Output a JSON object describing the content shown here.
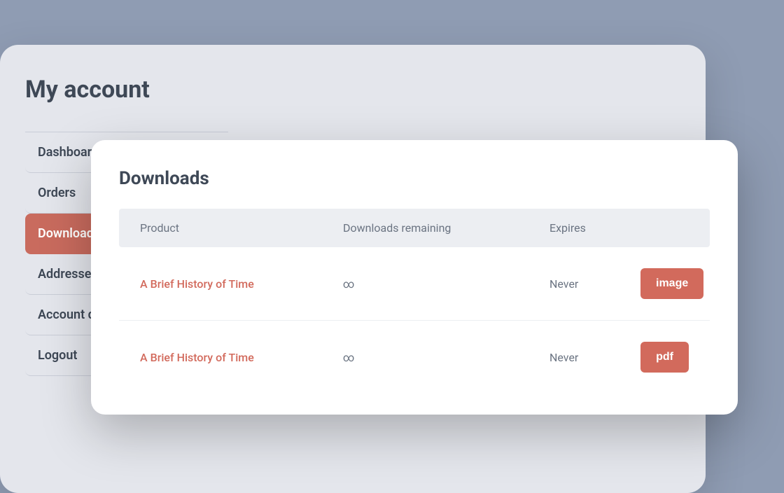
{
  "page": {
    "title": "My account"
  },
  "sidebar": {
    "items": [
      {
        "label": "Dashboard",
        "active": false
      },
      {
        "label": "Orders",
        "active": false
      },
      {
        "label": "Downloads",
        "active": true
      },
      {
        "label": "Addresses",
        "active": false
      },
      {
        "label": "Account details",
        "active": false
      },
      {
        "label": "Logout",
        "active": false
      }
    ]
  },
  "modal": {
    "title": "Downloads",
    "columns": {
      "product": "Product",
      "remaining": "Downloads remaining",
      "expires": "Expires"
    },
    "rows": [
      {
        "product": "A Brief History of Time",
        "remaining": "∞",
        "expires": "Never",
        "action": "image"
      },
      {
        "product": "A Brief History of Time",
        "remaining": "∞",
        "expires": "Never",
        "action": "pdf"
      }
    ]
  }
}
